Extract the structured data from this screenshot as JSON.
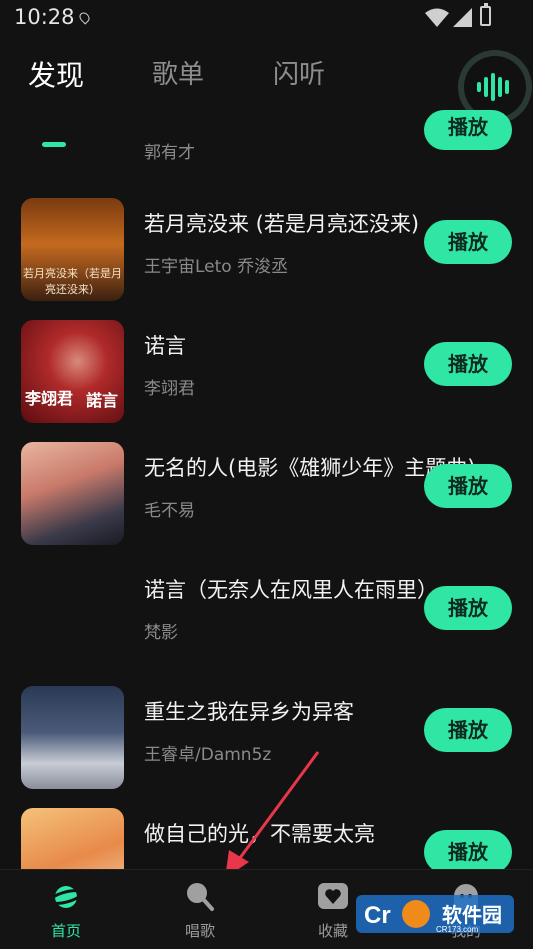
{
  "status_bar": {
    "time": "10:28"
  },
  "tabs": [
    {
      "label": "发现",
      "active": true
    },
    {
      "label": "歌单",
      "active": false
    },
    {
      "label": "闪听",
      "active": false
    }
  ],
  "accent_color": "#2fe6a5",
  "songs": [
    {
      "title": "",
      "artist": "郭有才",
      "play_label": "播放"
    },
    {
      "title": "若月亮没来 (若是月亮还没来)",
      "artist": "王宇宙Leto 乔浚丞",
      "play_label": "播放",
      "cover_caption": "若月亮没来（若是月亮还没来）"
    },
    {
      "title": "诺言",
      "artist": "李翊君",
      "play_label": "播放",
      "cover_caption_left": "李翊君",
      "cover_caption_right": "諾言"
    },
    {
      "title": "无名的人(电影《雄狮少年》主题曲)",
      "artist": "毛不易",
      "play_label": "播放"
    },
    {
      "title": "诺言（无奈人在风里人在雨里）",
      "artist": "梵影",
      "play_label": "播放"
    },
    {
      "title": "重生之我在异乡为异客",
      "artist": "王睿卓/Damn5z",
      "play_label": "播放"
    },
    {
      "title": "做自己的光，不需要太亮",
      "artist": "",
      "play_label": "播放"
    }
  ],
  "bottom_nav": [
    {
      "label": "首页",
      "icon": "planet-icon",
      "active": true
    },
    {
      "label": "唱歌",
      "icon": "microphone-icon",
      "active": false
    },
    {
      "label": "收藏",
      "icon": "heart-icon",
      "active": false
    },
    {
      "label": "我的",
      "icon": "ghost-icon",
      "active": false
    }
  ],
  "watermark": {
    "text": "软件园",
    "site": "CR173.com"
  }
}
